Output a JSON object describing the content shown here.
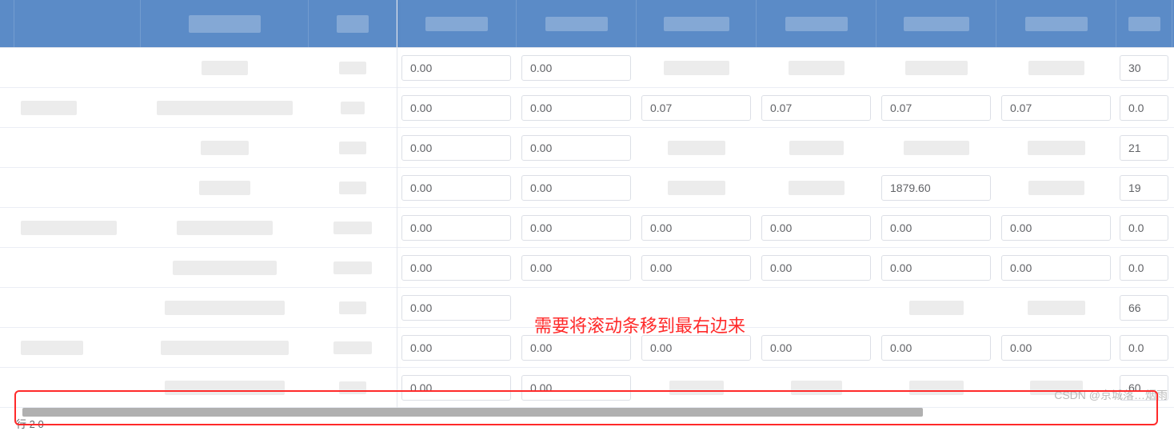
{
  "annotation_text": "需要将滚动条移到最右边来",
  "watermark": "CSDN @京城落…烟雨",
  "footer_label": "行  2 0",
  "header": {
    "col3_blur_w": 90,
    "col3_blur_h": 22,
    "col4_blur_w": 40,
    "col4_blur_h": 22,
    "cols": [
      {
        "blur_w": 78,
        "blur_h": 18
      },
      {
        "blur_w": 78,
        "blur_h": 18
      },
      {
        "blur_w": 82,
        "blur_h": 18
      },
      {
        "blur_w": 78,
        "blur_h": 18
      },
      {
        "blur_w": 82,
        "blur_h": 18
      },
      {
        "blur_w": 78,
        "blur_h": 18
      },
      {
        "blur_w": 40,
        "blur_h": 18
      }
    ]
  },
  "rows": [
    {
      "label_blur_w": 0,
      "name_blur_w": 58,
      "code_blur_w": 34,
      "cells": [
        {
          "val": "0.00"
        },
        {
          "val": "0.00"
        },
        {
          "blur_w": 82
        },
        {
          "blur_w": 70
        },
        {
          "blur_w": 78
        },
        {
          "blur_w": 70
        },
        {
          "val": "30"
        }
      ]
    },
    {
      "label_blur_w": 70,
      "name_blur_w": 170,
      "code_blur_w": 30,
      "cells": [
        {
          "val": "0.00"
        },
        {
          "val": "0.00"
        },
        {
          "val": "0.07"
        },
        {
          "val": "0.07"
        },
        {
          "val": "0.07"
        },
        {
          "val": "0.07"
        },
        {
          "val": "0.0"
        }
      ]
    },
    {
      "label_blur_w": 0,
      "name_blur_w": 60,
      "code_blur_w": 34,
      "cells": [
        {
          "val": "0.00"
        },
        {
          "val": "0.00"
        },
        {
          "blur_w": 72
        },
        {
          "blur_w": 68
        },
        {
          "blur_w": 82
        },
        {
          "blur_w": 72
        },
        {
          "val": "21"
        }
      ]
    },
    {
      "label_blur_w": 0,
      "name_blur_w": 64,
      "code_blur_w": 34,
      "cells": [
        {
          "val": "0.00"
        },
        {
          "val": "0.00"
        },
        {
          "blur_w": 72
        },
        {
          "blur_w": 70
        },
        {
          "val": "1879.60"
        },
        {
          "blur_w": 70
        },
        {
          "val": "19"
        }
      ]
    },
    {
      "label_blur_w": 120,
      "name_blur_w": 120,
      "code_blur_w": 48,
      "cells": [
        {
          "val": "0.00"
        },
        {
          "val": "0.00"
        },
        {
          "val": "0.00"
        },
        {
          "val": "0.00"
        },
        {
          "val": "0.00"
        },
        {
          "val": "0.00"
        },
        {
          "val": "0.0"
        }
      ]
    },
    {
      "label_blur_w": 0,
      "name_blur_w": 130,
      "code_blur_w": 48,
      "cells": [
        {
          "val": "0.00"
        },
        {
          "val": "0.00"
        },
        {
          "val": "0.00"
        },
        {
          "val": "0.00"
        },
        {
          "val": "0.00"
        },
        {
          "val": "0.00"
        },
        {
          "val": "0.0"
        }
      ]
    },
    {
      "label_blur_w": 0,
      "name_blur_w": 150,
      "code_blur_w": 34,
      "cells": [
        {
          "val": "0.00"
        },
        {
          "blur_w": 0
        },
        {
          "blur_w": 0
        },
        {
          "blur_w": 0
        },
        {
          "blur_w": 68
        },
        {
          "blur_w": 72
        },
        {
          "val": "66"
        }
      ]
    },
    {
      "label_blur_w": 78,
      "name_blur_w": 160,
      "code_blur_w": 48,
      "cells": [
        {
          "val": "0.00"
        },
        {
          "val": "0.00"
        },
        {
          "val": "0.00"
        },
        {
          "val": "0.00"
        },
        {
          "val": "0.00"
        },
        {
          "val": "0.00"
        },
        {
          "val": "0.0"
        }
      ]
    },
    {
      "label_blur_w": 0,
      "name_blur_w": 150,
      "code_blur_w": 34,
      "cells": [
        {
          "val": "0.00"
        },
        {
          "val": "0.00"
        },
        {
          "blur_w": 68
        },
        {
          "blur_w": 64
        },
        {
          "blur_w": 68
        },
        {
          "blur_w": 66
        },
        {
          "val": "60"
        }
      ]
    }
  ]
}
